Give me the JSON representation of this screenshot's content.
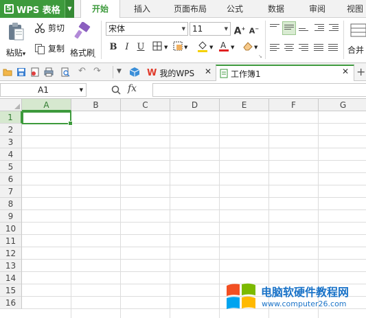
{
  "app": {
    "name": "WPS 表格"
  },
  "menu": {
    "tabs": [
      {
        "label": "开始",
        "active": true
      },
      {
        "label": "插入"
      },
      {
        "label": "页面布局"
      },
      {
        "label": "公式"
      },
      {
        "label": "数据"
      },
      {
        "label": "审阅"
      },
      {
        "label": "视图"
      }
    ]
  },
  "ribbon": {
    "paste_label": "粘贴",
    "paste_arrow": "▾",
    "cut_label": "剪切",
    "copy_label": "复制",
    "format_painter_label": "格式刷",
    "font_name": "宋体",
    "font_size": "11",
    "bold": "B",
    "italic": "I",
    "underline": "U",
    "merge_label": "合并"
  },
  "doc_tabs": [
    {
      "label": "我的WPS"
    },
    {
      "label": "工作簿1",
      "active": true
    }
  ],
  "formula_bar": {
    "name_box": "A1",
    "fx_label": "fx",
    "formula": ""
  },
  "sheet": {
    "columns": [
      "A",
      "B",
      "C",
      "D",
      "E",
      "F",
      "G"
    ],
    "rows": [
      "1",
      "2",
      "3",
      "4",
      "5",
      "6",
      "7",
      "8",
      "9",
      "10",
      "11",
      "12",
      "13",
      "14",
      "15",
      "16"
    ],
    "selected_cell": "A1"
  },
  "watermark": {
    "title": "电脑软硬件教程网",
    "url": "www.computer26.com"
  },
  "colors": {
    "accent": "#3d9a3c",
    "watermark_blue": "#1a73c8"
  }
}
